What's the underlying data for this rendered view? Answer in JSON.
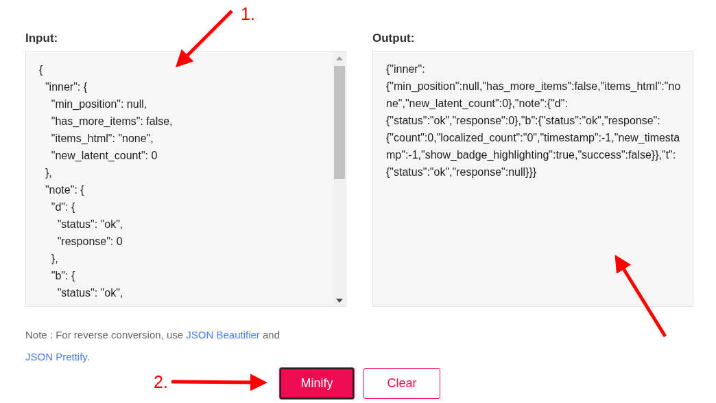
{
  "input": {
    "label": "Input:",
    "lines": [
      "{",
      "  \"inner\": {",
      "    \"min_position\": null,",
      "    \"has_more_items\": false,",
      "    \"items_html\": \"none\",",
      "    \"new_latent_count\": 0",
      "  },",
      "  \"note\": {",
      "    \"d\": {",
      "      \"status\": \"ok\",",
      "      \"response\": 0",
      "    },",
      "    \"b\": {",
      "      \"status\": \"ok\","
    ]
  },
  "output": {
    "label": "Output:",
    "value": "{\"inner\":{\"min_position\":null,\"has_more_items\":false,\"items_html\":\"none\",\"new_latent_count\":0},\"note\":{\"d\":{\"status\":\"ok\",\"response\":0},\"b\":{\"status\":\"ok\",\"response\":{\"count\":0,\"localized_count\":\"0\",\"timestamp\":-1,\"new_timestamp\":-1,\"show_badge_highlighting\":true,\"success\":false}},\"t\":{\"status\":\"ok\",\"response\":null}}}"
  },
  "note": {
    "text": "Note : For reverse conversion, use",
    "links": [
      "JSON Beautifier",
      "JSON Prettify"
    ],
    "joiner": "and",
    "end": "."
  },
  "buttons": [
    {
      "label": "Minify",
      "kind": "primary"
    },
    {
      "label": "Clear",
      "kind": "outline"
    }
  ],
  "annotations": [
    "1.",
    "2."
  ]
}
